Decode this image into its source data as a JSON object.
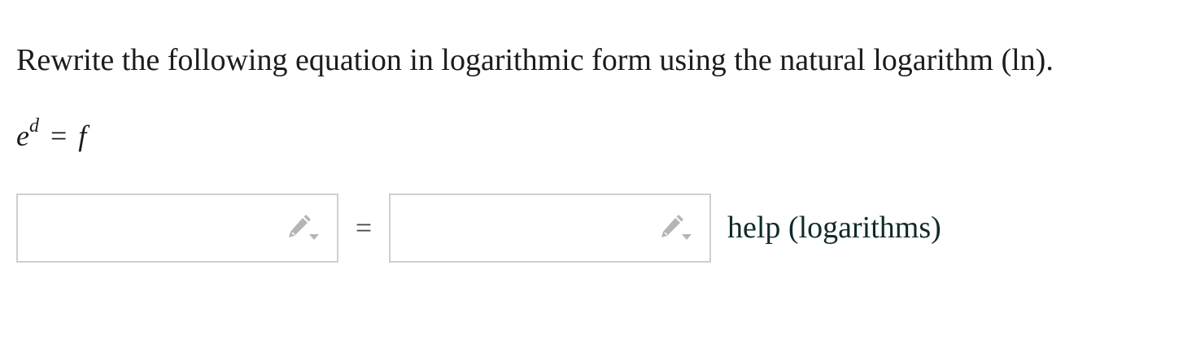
{
  "question": {
    "prompt": "Rewrite the following equation in logarithmic form using the natural logarithm (ln)."
  },
  "equation": {
    "base": "e",
    "exponent": "d",
    "operator": "=",
    "rhs": "f"
  },
  "answer": {
    "left_value": "",
    "equals": "=",
    "right_value": "",
    "icon": "pencil-icon",
    "help_link": "help (logarithms)"
  },
  "colors": {
    "text": "#1c1c1c",
    "box_border": "#cfcfcf",
    "icon": "#b5b5b5",
    "help_link": "#102a2a"
  }
}
